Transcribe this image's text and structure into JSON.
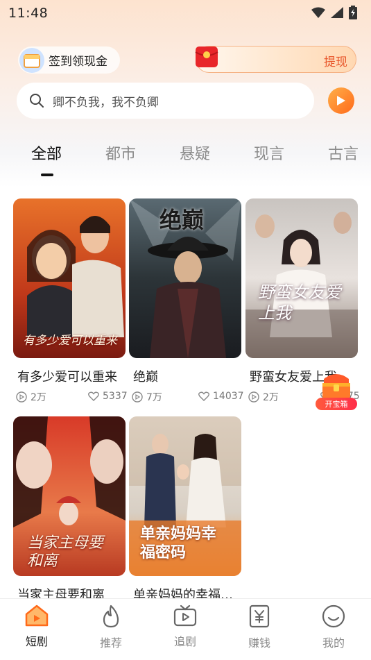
{
  "status_bar": {
    "time": "11:48"
  },
  "header": {
    "signin_label": "签到领现金",
    "withdraw_label": "提现"
  },
  "search": {
    "placeholder": "卿不负我，我不负卿"
  },
  "tabs": [
    {
      "label": "全部",
      "active": true
    },
    {
      "label": "都市",
      "active": false
    },
    {
      "label": "悬疑",
      "active": false
    },
    {
      "label": "现言",
      "active": false
    },
    {
      "label": "古言",
      "active": false
    }
  ],
  "dramas": [
    {
      "title": "有多少爱可以重来",
      "views": "2万",
      "likes": "5337",
      "poster_text": "有多少爱可以重来"
    },
    {
      "title": "绝巅",
      "views": "7万",
      "likes": "14037",
      "poster_text": "绝巅"
    },
    {
      "title": "野蛮女友爱上我",
      "views": "2万",
      "likes": "1175",
      "poster_text": "野蛮女友爱上我"
    },
    {
      "title": "当家主母要和离",
      "poster_text": "当家主母要和离"
    },
    {
      "title": "单亲妈妈的幸福…",
      "poster_text": "单亲妈妈幸福密码"
    }
  ],
  "treasure": {
    "label": "开宝箱"
  },
  "bottom_nav": [
    {
      "label": "短剧",
      "icon": "home-tv-icon",
      "active": true
    },
    {
      "label": "推荐",
      "icon": "flame-icon",
      "active": false
    },
    {
      "label": "追剧",
      "icon": "tv-play-icon",
      "active": false
    },
    {
      "label": "赚钱",
      "icon": "yuan-icon",
      "active": false
    },
    {
      "label": "我的",
      "icon": "smile-icon",
      "active": false
    }
  ],
  "colors": {
    "accent": "#ff7a1a",
    "withdraw": "#e8562a"
  }
}
